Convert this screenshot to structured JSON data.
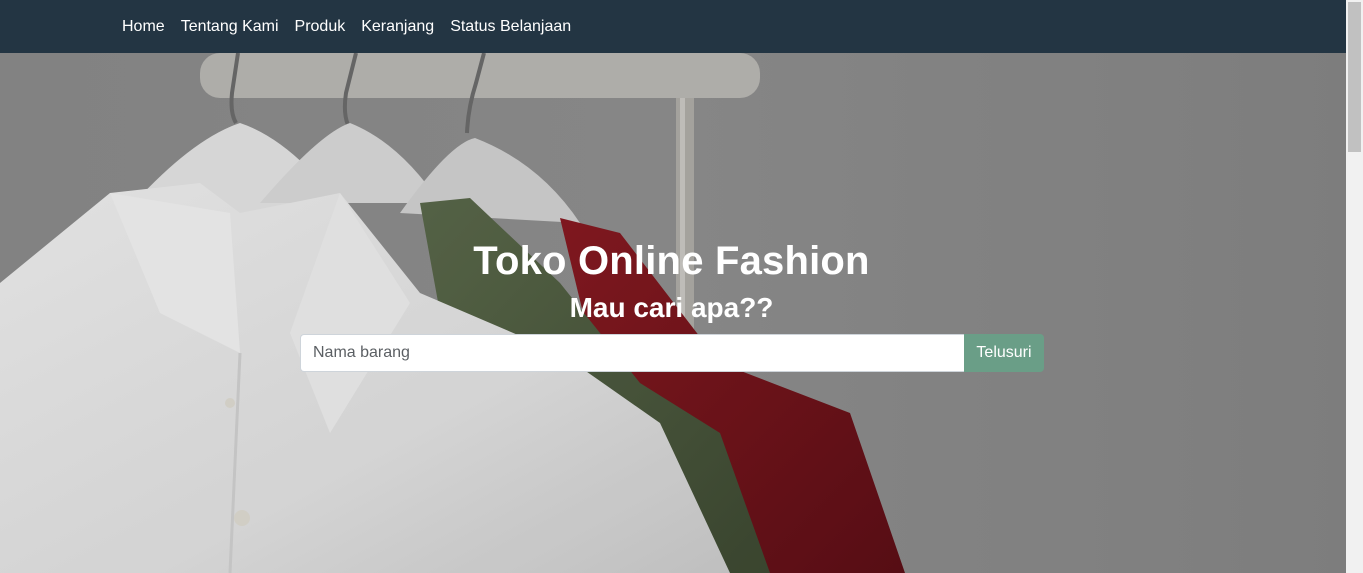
{
  "navbar": {
    "items": [
      {
        "label": "Home"
      },
      {
        "label": "Tentang Kami"
      },
      {
        "label": "Produk"
      },
      {
        "label": "Keranjang"
      },
      {
        "label": "Status Belanjaan"
      }
    ],
    "background": "#233543"
  },
  "hero": {
    "title": "Toko Online Fashion",
    "subtitle": "Mau cari apa??",
    "search": {
      "placeholder": "Nama barang",
      "value": "",
      "button_label": "Telusuri",
      "button_color": "#6a9e87"
    },
    "image": "clothes-rack-shirts-photo"
  }
}
